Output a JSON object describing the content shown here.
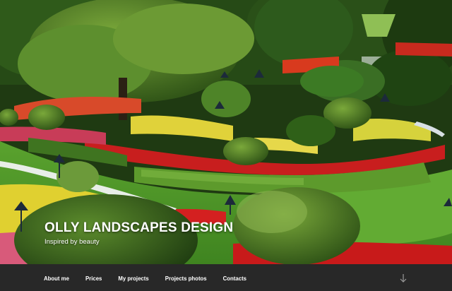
{
  "site": {
    "title": "OLLY LANDSCAPES DESIGN",
    "tagline": "Inspired by beauty"
  },
  "nav": {
    "items": [
      {
        "label": "About me"
      },
      {
        "label": "Prices"
      },
      {
        "label": "My projects"
      },
      {
        "label": "Projects photos"
      },
      {
        "label": "Contacts"
      }
    ],
    "scroll_icon": "arrow-down-icon"
  },
  "colors": {
    "navbar_bg": "#282828",
    "nav_text": "#ffffff",
    "lawn": "#4e9a2a"
  }
}
